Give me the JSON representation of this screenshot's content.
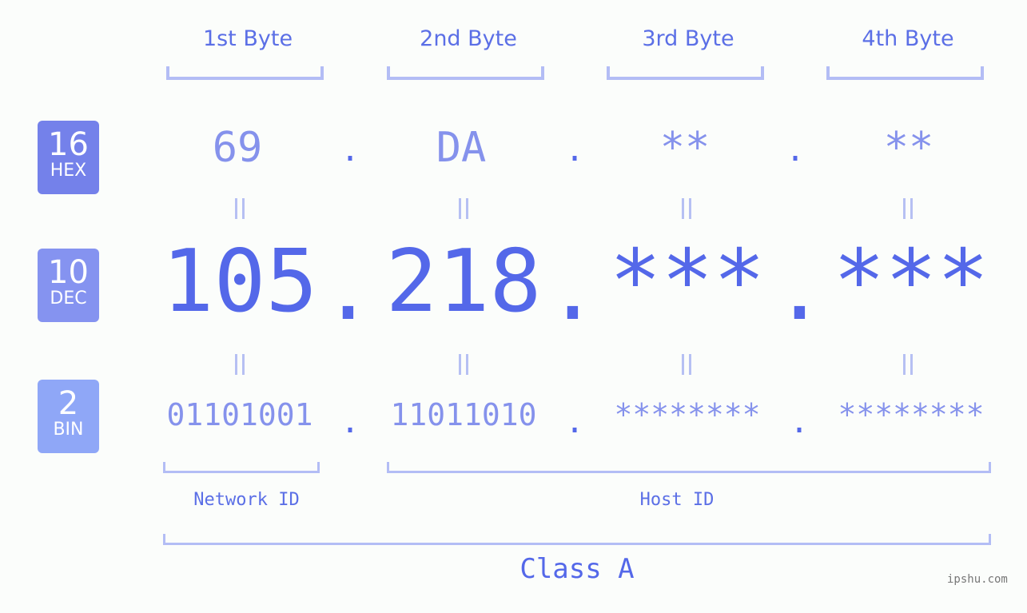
{
  "byte_headers": [
    "1st Byte",
    "2nd Byte",
    "3rd Byte",
    "4th Byte"
  ],
  "badges": {
    "hex": {
      "num": "16",
      "label": "HEX",
      "color": "#7481ea"
    },
    "dec": {
      "num": "10",
      "label": "DEC",
      "color": "#8593f0"
    },
    "bin": {
      "num": "2",
      "label": "BIN",
      "color": "#8fa7f7"
    }
  },
  "hex": [
    "69",
    "DA",
    "**",
    "**"
  ],
  "dec": [
    "105",
    "218",
    "***",
    "***"
  ],
  "bin": [
    "01101001",
    "11011010",
    "********",
    "********"
  ],
  "separator": ".",
  "equals": "=",
  "network_label": "Network ID",
  "host_label": "Host ID",
  "class_label": "Class A",
  "brand": "ipshu.com",
  "colors": {
    "accent": "#5468e9",
    "light": "#8592ec",
    "bracket": "#b3bdf5"
  }
}
